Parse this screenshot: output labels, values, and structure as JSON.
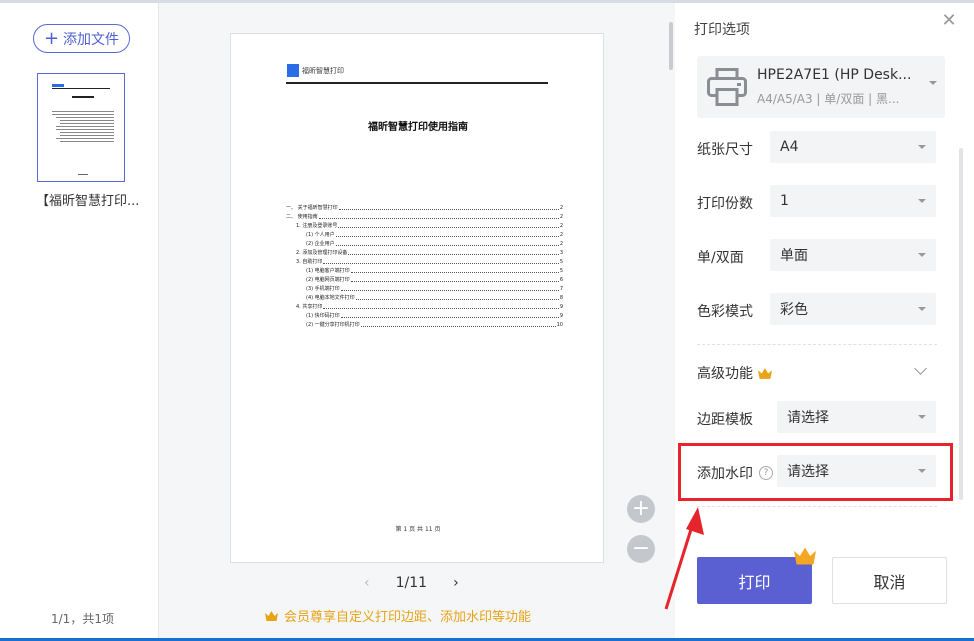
{
  "left": {
    "add_file_label": "添加文件",
    "file_name": "【福昕智慧打印...",
    "page_count": "1/1，共1项"
  },
  "preview": {
    "logo_text": "福昕智慧打印",
    "doc_title": "福昕智慧打印使用指南",
    "toc": [
      {
        "label": "一、 关于福昕智慧打印",
        "page": "2",
        "indent": 0
      },
      {
        "label": "二、 使用指南",
        "page": "2",
        "indent": 0
      },
      {
        "label": "1. 注册及登录账号",
        "page": "2",
        "indent": 1
      },
      {
        "label": "(1)  个人用户",
        "page": "2",
        "indent": 2
      },
      {
        "label": "(2)  企业用户",
        "page": "2",
        "indent": 2
      },
      {
        "label": "2. 添加及管理打印设备",
        "page": "3",
        "indent": 1
      },
      {
        "label": "3. 自助打印",
        "page": "5",
        "indent": 1
      },
      {
        "label": "(1)  电脑客户端打印",
        "page": "5",
        "indent": 2
      },
      {
        "label": "(2)  电脑网页端打印",
        "page": "6",
        "indent": 2
      },
      {
        "label": "(3)  手机端打印",
        "page": "7",
        "indent": 2
      },
      {
        "label": "(4)  电脑本地文件打印",
        "page": "8",
        "indent": 2
      },
      {
        "label": "4. 共享打印",
        "page": "9",
        "indent": 1
      },
      {
        "label": "(1)  快印码打印",
        "page": "9",
        "indent": 2
      },
      {
        "label": "(2)  一键分享打印机打印",
        "page": "10",
        "indent": 2
      }
    ],
    "footer": "第 1 页 共 11 页",
    "pager": "1/11",
    "vip_note": "会员尊享自定义打印边距、添加水印等功能"
  },
  "panel": {
    "title": "打印选项",
    "printer_name": "HPE2A7E1 (HP Desk...",
    "printer_desc": "A4/A5/A3 | 单/双面 | 黑...",
    "paper_size_label": "纸张尺寸",
    "paper_size_value": "A4",
    "copies_label": "打印份数",
    "copies_value": "1",
    "duplex_label": "单/双面",
    "duplex_value": "单面",
    "color_label": "色彩模式",
    "color_value": "彩色",
    "advanced_label": "高级功能",
    "margin_label": "边距模板",
    "margin_value": "请选择",
    "watermark_label": "添加水印",
    "watermark_value": "请选择",
    "print_label": "打印",
    "cancel_label": "取消"
  },
  "colors": {
    "accent": "#5a5fd2",
    "vip": "#e8a317",
    "highlight": "#e5242b"
  }
}
